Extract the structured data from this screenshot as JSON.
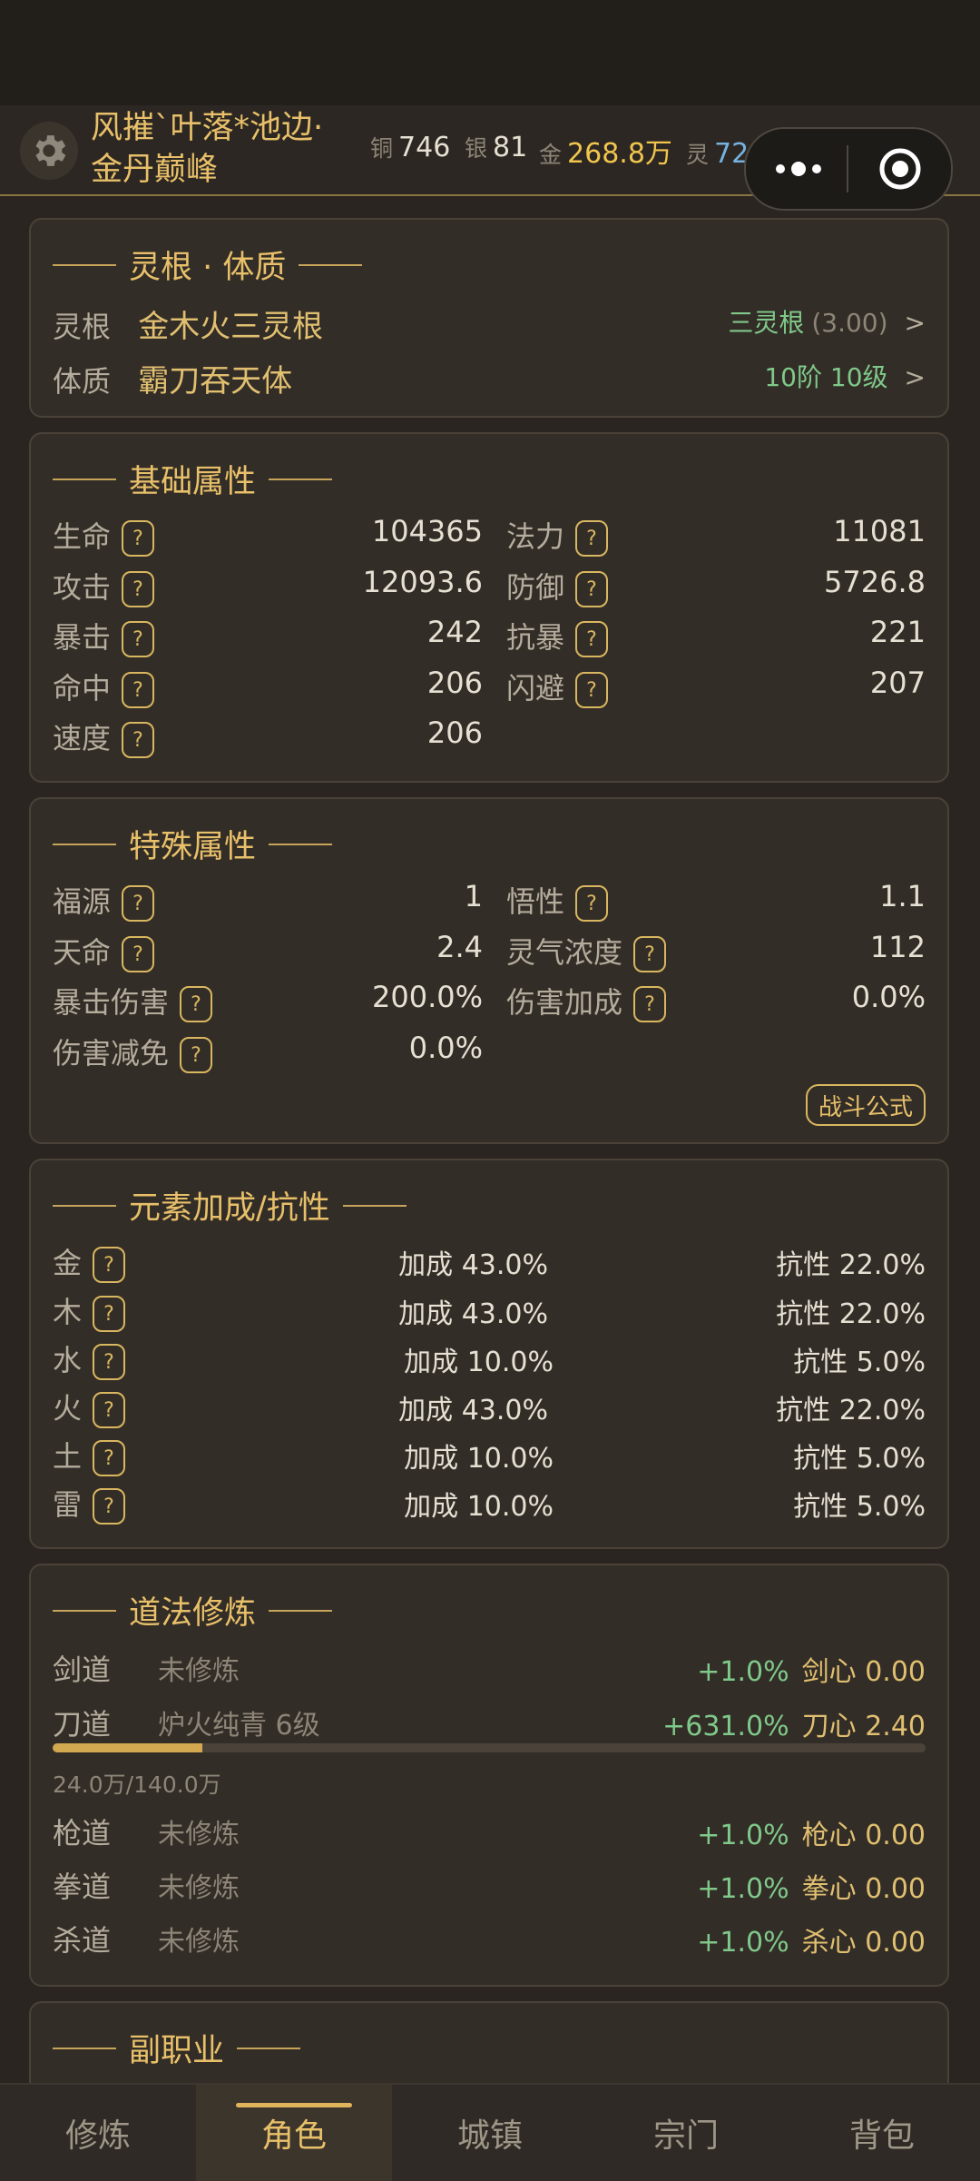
{
  "header": {
    "player_name": "风摧`叶落*池边·",
    "realm": "金丹巅峰",
    "currencies": [
      {
        "key": "铜",
        "value": "746",
        "color": "#e6e0d3"
      },
      {
        "key": "银",
        "value": "81",
        "color": "#e6e0d3"
      },
      {
        "key": "金",
        "value": "268.8万",
        "color": "#f2c64e"
      },
      {
        "key": "灵",
        "value": "72.8万",
        "color": "#76b2df"
      }
    ],
    "icons": [
      "gear-icon",
      "more-dots-icon",
      "record-icon"
    ]
  },
  "spirit": {
    "title": "灵根 · 体质",
    "root_label": "灵根",
    "root_value": "金木火三灵根",
    "root_grade": "三灵根",
    "root_score": "(3.00)",
    "body_label": "体质",
    "body_value": "霸刀吞天体",
    "body_level": "10阶 10级",
    "arrow": ">"
  },
  "basic": {
    "title": "基础属性",
    "left": [
      {
        "label": "生命",
        "value": "104365"
      },
      {
        "label": "攻击",
        "value": "12093.6"
      },
      {
        "label": "暴击",
        "value": "242"
      },
      {
        "label": "命中",
        "value": "206"
      },
      {
        "label": "速度",
        "value": "206"
      }
    ],
    "right": [
      {
        "label": "法力",
        "value": "11081"
      },
      {
        "label": "防御",
        "value": "5726.8"
      },
      {
        "label": "抗暴",
        "value": "221"
      },
      {
        "label": "闪避",
        "value": "207"
      }
    ]
  },
  "special": {
    "title": "特殊属性",
    "left": [
      {
        "label": "福源",
        "value": "1"
      },
      {
        "label": "天命",
        "value": "2.4"
      },
      {
        "label": "暴击伤害",
        "value": "200.0%"
      },
      {
        "label": "伤害减免",
        "value": "0.0%"
      }
    ],
    "right": [
      {
        "label": "悟性",
        "value": "1.1"
      },
      {
        "label": "灵气浓度",
        "value": "112"
      },
      {
        "label": "伤害加成",
        "value": "0.0%"
      }
    ],
    "formula_button": "战斗公式"
  },
  "elements": {
    "title": "元素加成/抗性",
    "rows": [
      {
        "label": "金",
        "bonus": "加成 43.0%",
        "resist": "抗性 22.0%"
      },
      {
        "label": "木",
        "bonus": "加成 43.0%",
        "resist": "抗性 22.0%"
      },
      {
        "label": "水",
        "bonus": "加成 10.0%",
        "resist": "抗性 5.0%"
      },
      {
        "label": "火",
        "bonus": "加成 43.0%",
        "resist": "抗性 22.0%"
      },
      {
        "label": "土",
        "bonus": "加成 10.0%",
        "resist": "抗性 5.0%"
      },
      {
        "label": "雷",
        "bonus": "加成 10.0%",
        "resist": "抗性 5.0%"
      }
    ]
  },
  "dao": {
    "title": "道法修炼",
    "rows": [
      {
        "label": "剑道",
        "status": "未修炼",
        "bonus": "+1.0%",
        "heart": "剑心 0.00"
      },
      {
        "label": "刀道",
        "status": "炉火纯青 6级",
        "bonus": "+631.0%",
        "heart": "刀心 2.40"
      },
      {
        "label": "枪道",
        "status": "未修炼",
        "bonus": "+1.0%",
        "heart": "枪心 0.00"
      },
      {
        "label": "拳道",
        "status": "未修炼",
        "bonus": "+1.0%",
        "heart": "拳心 0.00"
      },
      {
        "label": "杀道",
        "status": "未修炼",
        "bonus": "+1.0%",
        "heart": "杀心 0.00"
      }
    ],
    "progress_text": "24.0万/140.0万",
    "progress_fraction": 0.171
  },
  "subjob": {
    "title": "副职业"
  },
  "tabs": [
    {
      "label": "修炼",
      "active": false
    },
    {
      "label": "角色",
      "active": true
    },
    {
      "label": "城镇",
      "active": false
    },
    {
      "label": "宗门",
      "active": false
    },
    {
      "label": "背包",
      "active": false
    }
  ],
  "question_mark": "?"
}
